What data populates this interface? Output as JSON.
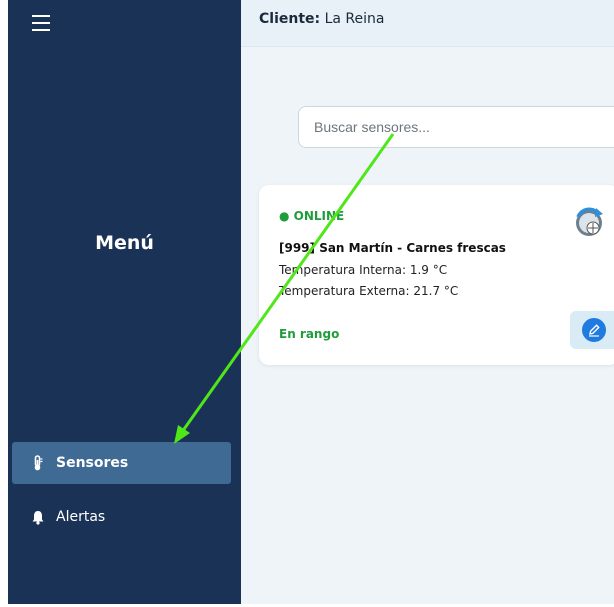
{
  "sidebar": {
    "menu_title": "Menú",
    "items": [
      {
        "label": "Sensores",
        "icon": "thermometer-icon",
        "active": true
      },
      {
        "label": "Alertas",
        "icon": "bell-icon",
        "active": false
      }
    ]
  },
  "header": {
    "client_label": "Cliente:",
    "client_name": "La Reina"
  },
  "search": {
    "placeholder": "Buscar sensores..."
  },
  "sensor_card": {
    "status": "● ONLINE",
    "name": "[999] San Martín - Carnes frescas",
    "temp_internal": "Temperatura Interna: 1.9 °C",
    "temp_external": "Temperatura Externa: 21.7 °C",
    "range_status": "En rango"
  },
  "colors": {
    "sidebar_bg": "#1b3257",
    "active_item_bg": "#3f6a93",
    "online_green": "#1f9d3a",
    "annotation_arrow": "#4fe61a"
  }
}
